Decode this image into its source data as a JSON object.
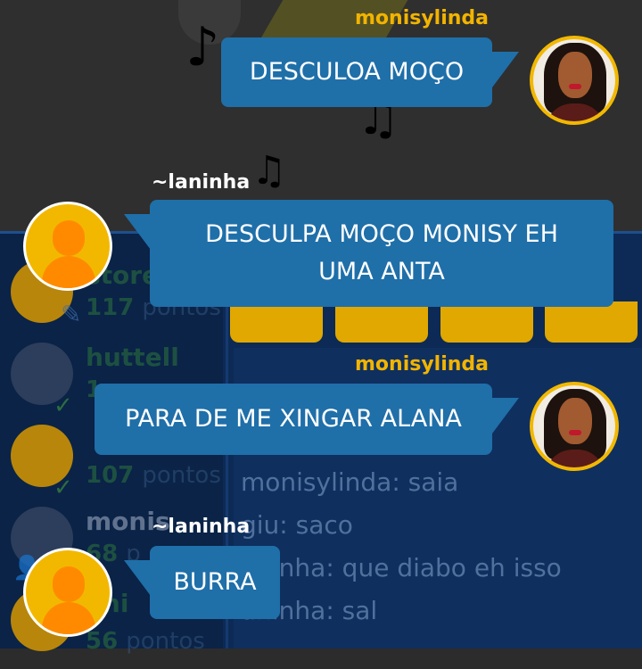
{
  "background": {
    "players": [
      {
        "name": "store",
        "score": "117",
        "score_unit": "pontos"
      },
      {
        "name": "huttell",
        "score": "1",
        "score_unit": ""
      },
      {
        "name": "",
        "score": "107",
        "score_unit": "pontos"
      },
      {
        "name": "monis",
        "score": "68",
        "score_unit": "p"
      },
      {
        "name": "ani",
        "score": "56",
        "score_unit": "pontos"
      }
    ],
    "chat_lines": [
      "monisylinda: saia",
      "giu: saco",
      "aninha: que diabo eh isso",
      "aninha: sal"
    ]
  },
  "messages": [
    {
      "user": "monisylinda",
      "text": "DESCULOA MOÇO",
      "side": "right",
      "avatar": "photo-avatar"
    },
    {
      "user": "~laninha",
      "text": "DESCULPA MOÇO MONISY EH UMA ANTA",
      "side": "left",
      "avatar": "default-avatar"
    },
    {
      "user": "monisylinda",
      "text": "PARA DE ME XINGAR ALANA",
      "side": "right",
      "avatar": "photo-avatar"
    },
    {
      "user": "~laninha",
      "text": "BURRA",
      "side": "left",
      "avatar": "default-avatar"
    }
  ],
  "colors": {
    "bubble": "#1f6fa9",
    "username_gold": "#f2b400",
    "avatar_ring": "#f2b800",
    "default_avatar_figure": "#ff8a00"
  }
}
